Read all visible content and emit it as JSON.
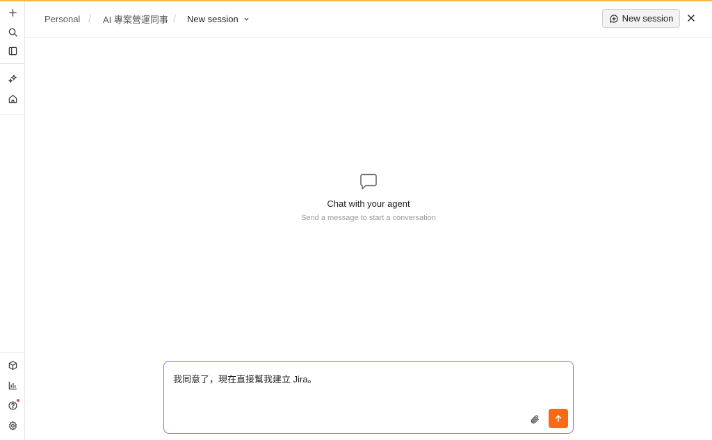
{
  "colors": {
    "accent_top": "#f5b941",
    "composer_border": "#8b6cf0",
    "send_button": "#f76b15",
    "notification_dot": "#e5484d"
  },
  "sidebar": {
    "top_icons": [
      "plus-icon",
      "search-icon",
      "sidebar-panel-icon"
    ],
    "mid_icons": [
      "sparkles-icon",
      "home-icon"
    ],
    "bottom_icons": [
      "package-icon",
      "bar-chart-icon",
      "help-icon",
      "settings-icon"
    ]
  },
  "header": {
    "breadcrumbs": [
      "Personal",
      "AI 專案營運同事",
      "New session"
    ],
    "new_session_label": "New session"
  },
  "empty_state": {
    "title": "Chat with your agent",
    "subtitle": "Send a message to start a conversation"
  },
  "composer": {
    "value": "我同意了，現在直接幫我建立 Jira。"
  }
}
